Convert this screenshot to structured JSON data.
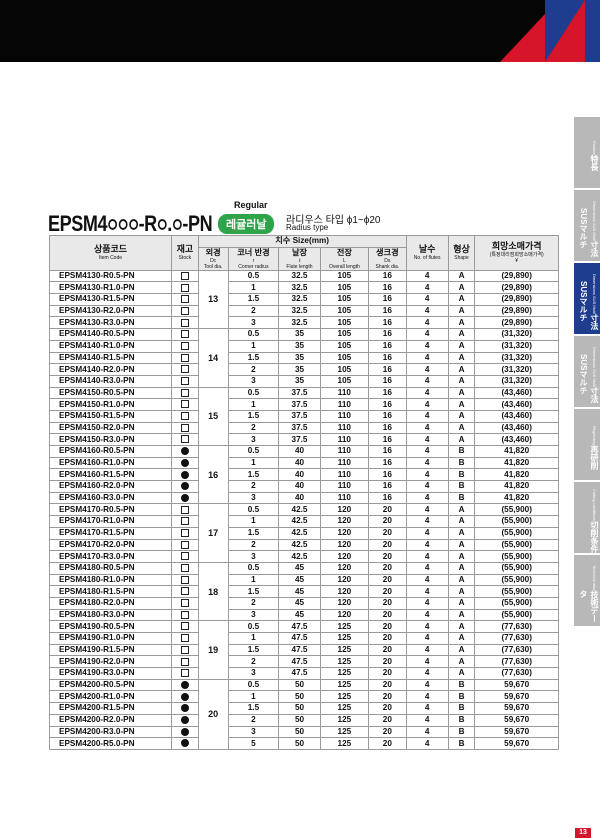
{
  "header": {
    "regular": "Regular",
    "title_prefix": "EPSM4",
    "title_hollow1": "○○○",
    "title_mid": "-R",
    "title_hollow2": "○",
    "title_dot": ".",
    "title_hollow3": "○",
    "title_suffix": "-PN",
    "pill": "레귤러날",
    "radius_kr": "라디우스 타입 ϕ1~ϕ20",
    "radius_en": "Radius type"
  },
  "table_headers": {
    "item_kr": "상품코드",
    "item_en": "Item Code",
    "stock_kr": "재고",
    "stock_en": "Stock",
    "size_group": "치수 Size(mm)",
    "dc_kr": "외경",
    "dc_sym": "Dc",
    "dc_en": "Tool dia.",
    "r_kr": "코너 반경",
    "r_sym": "r",
    "r_en": "Corner radius",
    "l1_kr": "날장",
    "l1_sym": "ℓ",
    "l1_en": "Flute length",
    "l_kr": "전장",
    "l_sym": "L",
    "l_en": "Overall length",
    "ds_kr": "생크경",
    "ds_sym": "Ds",
    "ds_en": "Shank dia.",
    "flutes_kr": "날수",
    "flutes_en": "No. of flutes",
    "shape_kr": "형상",
    "shape_en": "Shape",
    "price_kr": "희망소매가격",
    "price_sub": "(특정대리점희망소매가격)",
    "price_unit": "¥"
  },
  "groups": [
    {
      "dc": "13",
      "rows": [
        {
          "code": "EPSM4130-R0.5-PN",
          "stock": "open",
          "r": "0.5",
          "l1": "32.5",
          "l": "105",
          "ds": "16",
          "z": "4",
          "shape": "A",
          "price": "(29,890)"
        },
        {
          "code": "EPSM4130-R1.0-PN",
          "stock": "open",
          "r": "1",
          "l1": "32.5",
          "l": "105",
          "ds": "16",
          "z": "4",
          "shape": "A",
          "price": "(29,890)"
        },
        {
          "code": "EPSM4130-R1.5-PN",
          "stock": "open",
          "r": "1.5",
          "l1": "32.5",
          "l": "105",
          "ds": "16",
          "z": "4",
          "shape": "A",
          "price": "(29,890)"
        },
        {
          "code": "EPSM4130-R2.0-PN",
          "stock": "open",
          "r": "2",
          "l1": "32.5",
          "l": "105",
          "ds": "16",
          "z": "4",
          "shape": "A",
          "price": "(29,890)"
        },
        {
          "code": "EPSM4130-R3.0-PN",
          "stock": "open",
          "r": "3",
          "l1": "32.5",
          "l": "105",
          "ds": "16",
          "z": "4",
          "shape": "A",
          "price": "(29,890)"
        }
      ]
    },
    {
      "dc": "14",
      "rows": [
        {
          "code": "EPSM4140-R0.5-PN",
          "stock": "open",
          "r": "0.5",
          "l1": "35",
          "l": "105",
          "ds": "16",
          "z": "4",
          "shape": "A",
          "price": "(31,320)"
        },
        {
          "code": "EPSM4140-R1.0-PN",
          "stock": "open",
          "r": "1",
          "l1": "35",
          "l": "105",
          "ds": "16",
          "z": "4",
          "shape": "A",
          "price": "(31,320)"
        },
        {
          "code": "EPSM4140-R1.5-PN",
          "stock": "open",
          "r": "1.5",
          "l1": "35",
          "l": "105",
          "ds": "16",
          "z": "4",
          "shape": "A",
          "price": "(31,320)"
        },
        {
          "code": "EPSM4140-R2.0-PN",
          "stock": "open",
          "r": "2",
          "l1": "35",
          "l": "105",
          "ds": "16",
          "z": "4",
          "shape": "A",
          "price": "(31,320)"
        },
        {
          "code": "EPSM4140-R3.0-PN",
          "stock": "open",
          "r": "3",
          "l1": "35",
          "l": "105",
          "ds": "16",
          "z": "4",
          "shape": "A",
          "price": "(31,320)"
        }
      ]
    },
    {
      "dc": "15",
      "rows": [
        {
          "code": "EPSM4150-R0.5-PN",
          "stock": "open",
          "r": "0.5",
          "l1": "37.5",
          "l": "110",
          "ds": "16",
          "z": "4",
          "shape": "A",
          "price": "(43,460)"
        },
        {
          "code": "EPSM4150-R1.0-PN",
          "stock": "open",
          "r": "1",
          "l1": "37.5",
          "l": "110",
          "ds": "16",
          "z": "4",
          "shape": "A",
          "price": "(43,460)"
        },
        {
          "code": "EPSM4150-R1.5-PN",
          "stock": "open",
          "r": "1.5",
          "l1": "37.5",
          "l": "110",
          "ds": "16",
          "z": "4",
          "shape": "A",
          "price": "(43,460)"
        },
        {
          "code": "EPSM4150-R2.0-PN",
          "stock": "open",
          "r": "2",
          "l1": "37.5",
          "l": "110",
          "ds": "16",
          "z": "4",
          "shape": "A",
          "price": "(43,460)"
        },
        {
          "code": "EPSM4150-R3.0-PN",
          "stock": "open",
          "r": "3",
          "l1": "37.5",
          "l": "110",
          "ds": "16",
          "z": "4",
          "shape": "A",
          "price": "(43,460)"
        }
      ]
    },
    {
      "dc": "16",
      "rows": [
        {
          "code": "EPSM4160-R0.5-PN",
          "stock": "filled",
          "r": "0.5",
          "l1": "40",
          "l": "110",
          "ds": "16",
          "z": "4",
          "shape": "B",
          "price": "41,820"
        },
        {
          "code": "EPSM4160-R1.0-PN",
          "stock": "filled",
          "r": "1",
          "l1": "40",
          "l": "110",
          "ds": "16",
          "z": "4",
          "shape": "B",
          "price": "41,820"
        },
        {
          "code": "EPSM4160-R1.5-PN",
          "stock": "filled",
          "r": "1.5",
          "l1": "40",
          "l": "110",
          "ds": "16",
          "z": "4",
          "shape": "B",
          "price": "41,820"
        },
        {
          "code": "EPSM4160-R2.0-PN",
          "stock": "filled",
          "r": "2",
          "l1": "40",
          "l": "110",
          "ds": "16",
          "z": "4",
          "shape": "B",
          "price": "41,820"
        },
        {
          "code": "EPSM4160-R3.0-PN",
          "stock": "filled",
          "r": "3",
          "l1": "40",
          "l": "110",
          "ds": "16",
          "z": "4",
          "shape": "B",
          "price": "41,820"
        }
      ]
    },
    {
      "dc": "17",
      "rows": [
        {
          "code": "EPSM4170-R0.5-PN",
          "stock": "open",
          "r": "0.5",
          "l1": "42.5",
          "l": "120",
          "ds": "20",
          "z": "4",
          "shape": "A",
          "price": "(55,900)"
        },
        {
          "code": "EPSM4170-R1.0-PN",
          "stock": "open",
          "r": "1",
          "l1": "42.5",
          "l": "120",
          "ds": "20",
          "z": "4",
          "shape": "A",
          "price": "(55,900)"
        },
        {
          "code": "EPSM4170-R1.5-PN",
          "stock": "open",
          "r": "1.5",
          "l1": "42.5",
          "l": "120",
          "ds": "20",
          "z": "4",
          "shape": "A",
          "price": "(55,900)"
        },
        {
          "code": "EPSM4170-R2.0-PN",
          "stock": "open",
          "r": "2",
          "l1": "42.5",
          "l": "120",
          "ds": "20",
          "z": "4",
          "shape": "A",
          "price": "(55,900)"
        },
        {
          "code": "EPSM4170-R3.0-PN",
          "stock": "open",
          "r": "3",
          "l1": "42.5",
          "l": "120",
          "ds": "20",
          "z": "4",
          "shape": "A",
          "price": "(55,900)"
        }
      ]
    },
    {
      "dc": "18",
      "rows": [
        {
          "code": "EPSM4180-R0.5-PN",
          "stock": "open",
          "r": "0.5",
          "l1": "45",
          "l": "120",
          "ds": "20",
          "z": "4",
          "shape": "A",
          "price": "(55,900)"
        },
        {
          "code": "EPSM4180-R1.0-PN",
          "stock": "open",
          "r": "1",
          "l1": "45",
          "l": "120",
          "ds": "20",
          "z": "4",
          "shape": "A",
          "price": "(55,900)"
        },
        {
          "code": "EPSM4180-R1.5-PN",
          "stock": "open",
          "r": "1.5",
          "l1": "45",
          "l": "120",
          "ds": "20",
          "z": "4",
          "shape": "A",
          "price": "(55,900)"
        },
        {
          "code": "EPSM4180-R2.0-PN",
          "stock": "open",
          "r": "2",
          "l1": "45",
          "l": "120",
          "ds": "20",
          "z": "4",
          "shape": "A",
          "price": "(55,900)"
        },
        {
          "code": "EPSM4180-R3.0-PN",
          "stock": "open",
          "r": "3",
          "l1": "45",
          "l": "120",
          "ds": "20",
          "z": "4",
          "shape": "A",
          "price": "(55,900)"
        }
      ]
    },
    {
      "dc": "19",
      "rows": [
        {
          "code": "EPSM4190-R0.5-PN",
          "stock": "open",
          "r": "0.5",
          "l1": "47.5",
          "l": "125",
          "ds": "20",
          "z": "4",
          "shape": "A",
          "price": "(77,630)"
        },
        {
          "code": "EPSM4190-R1.0-PN",
          "stock": "open",
          "r": "1",
          "l1": "47.5",
          "l": "125",
          "ds": "20",
          "z": "4",
          "shape": "A",
          "price": "(77,630)"
        },
        {
          "code": "EPSM4190-R1.5-PN",
          "stock": "open",
          "r": "1.5",
          "l1": "47.5",
          "l": "125",
          "ds": "20",
          "z": "4",
          "shape": "A",
          "price": "(77,630)"
        },
        {
          "code": "EPSM4190-R2.0-PN",
          "stock": "open",
          "r": "2",
          "l1": "47.5",
          "l": "125",
          "ds": "20",
          "z": "4",
          "shape": "A",
          "price": "(77,630)"
        },
        {
          "code": "EPSM4190-R3.0-PN",
          "stock": "open",
          "r": "3",
          "l1": "47.5",
          "l": "125",
          "ds": "20",
          "z": "4",
          "shape": "A",
          "price": "(77,630)"
        }
      ]
    },
    {
      "dc": "20",
      "rows": [
        {
          "code": "EPSM4200-R0.5-PN",
          "stock": "filled",
          "r": "0.5",
          "l1": "50",
          "l": "125",
          "ds": "20",
          "z": "4",
          "shape": "B",
          "price": "59,670"
        },
        {
          "code": "EPSM4200-R1.0-PN",
          "stock": "filled",
          "r": "1",
          "l1": "50",
          "l": "125",
          "ds": "20",
          "z": "4",
          "shape": "B",
          "price": "59,670"
        },
        {
          "code": "EPSM4200-R1.5-PN",
          "stock": "filled",
          "r": "1.5",
          "l1": "50",
          "l": "125",
          "ds": "20",
          "z": "4",
          "shape": "B",
          "price": "59,670"
        },
        {
          "code": "EPSM4200-R2.0-PN",
          "stock": "filled",
          "r": "2",
          "l1": "50",
          "l": "125",
          "ds": "20",
          "z": "4",
          "shape": "B",
          "price": "59,670"
        },
        {
          "code": "EPSM4200-R3.0-PN",
          "stock": "filled",
          "r": "3",
          "l1": "50",
          "l": "125",
          "ds": "20",
          "z": "4",
          "shape": "B",
          "price": "59,670"
        },
        {
          "code": "EPSM4200-R5.0-PN",
          "stock": "filled",
          "r": "5",
          "l1": "50",
          "l": "125",
          "ds": "20",
          "z": "4",
          "shape": "B",
          "price": "59,670"
        }
      ]
    }
  ],
  "side_tabs": [
    {
      "label": "特長",
      "en": "Feature",
      "active": false
    },
    {
      "label": "寸法 SUSマルチ",
      "en": "Dimensions SUS Multi",
      "active": false
    },
    {
      "label": "寸法 SUSマルチ",
      "en": "Dimensions SUS Multi",
      "active": true
    },
    {
      "label": "寸法 SUSマルチ",
      "en": "Dimensions SUS Multi",
      "active": false
    },
    {
      "label": "再研削",
      "en": "Regrinding",
      "active": false
    },
    {
      "label": "切削条件",
      "en": "Cutting conditions",
      "active": false
    },
    {
      "label": "技術データ",
      "en": "Technical data",
      "active": false
    }
  ],
  "page_number": "13",
  "colors": {
    "accent_red": "#d6142a",
    "accent_blue": "#1e3d8f",
    "pill_green": "#2fa34a"
  }
}
